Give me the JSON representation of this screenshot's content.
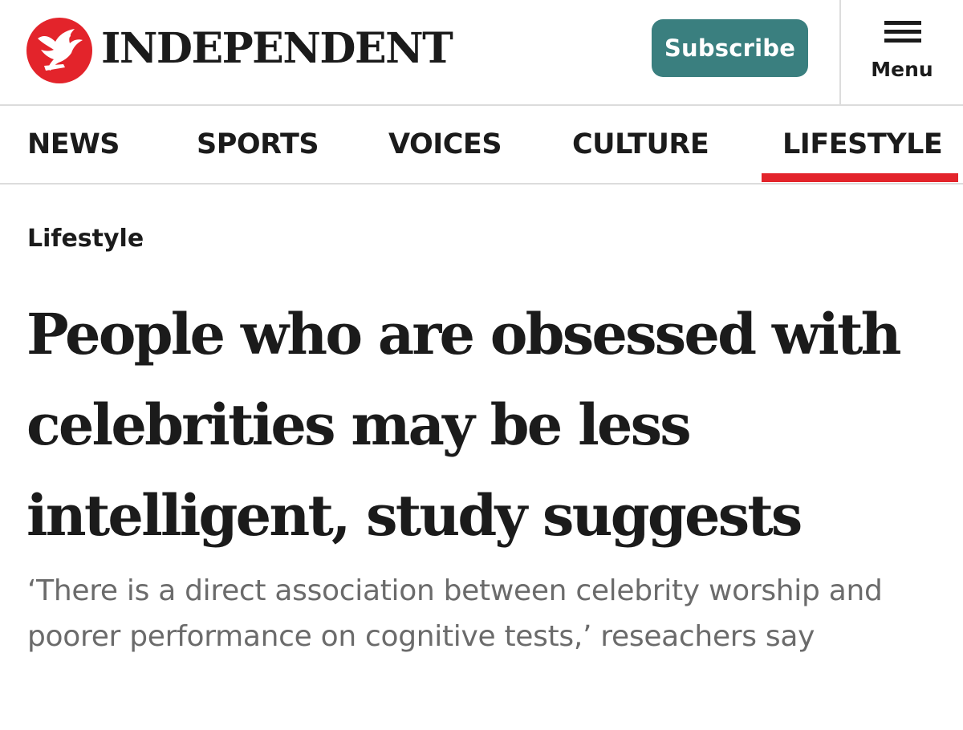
{
  "header": {
    "logo_text": "INDEPENDENT",
    "subscribe_label": "Subscribe",
    "menu_label": "Menu"
  },
  "nav": {
    "items": [
      {
        "label": "NEWS"
      },
      {
        "label": "SPORTS"
      },
      {
        "label": "VOICES"
      },
      {
        "label": "CULTURE"
      },
      {
        "label": "LIFESTYLE"
      }
    ],
    "active": "LIFESTYLE"
  },
  "article": {
    "section": "Lifestyle",
    "headline": "People who are obsessed with celebrities may be less intelligent, study suggests",
    "standfirst": "‘There is a direct association between celebrity worship and poorer performance on cognitive tests,’ reseachers say"
  },
  "colors": {
    "brand_red": "#e3242b",
    "subscribe_teal": "#3a7f7f",
    "text": "#1b1b1b",
    "standfirst_gray": "#6b6b6b",
    "divider": "#dcdcdc"
  },
  "icons": {
    "logo": "eagle-logo-icon",
    "menu": "hamburger-icon"
  }
}
